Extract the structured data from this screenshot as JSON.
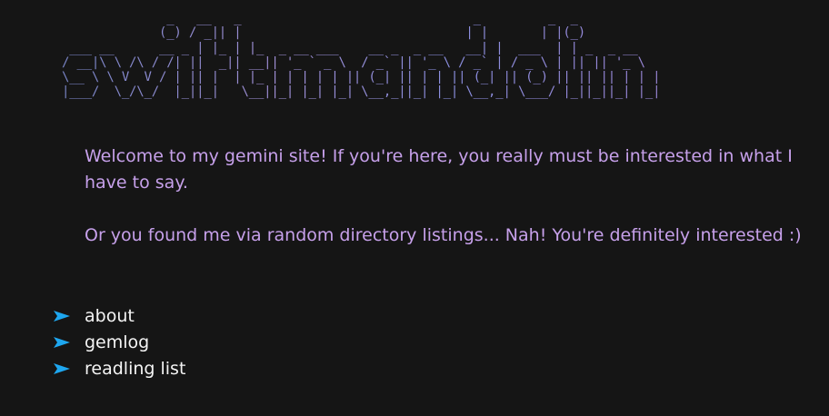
{
  "banner": {
    "ascii_art": "              _   __   _                               _         _  _\n             (_) / _|| |                              | |       | |(_)\n ___ __      __ _ | |_ | |_  _ __ ___    __ _  _ __   __| |  ___  | | _  _ __\n/ __|\\ \\ /\\ / /| ||  _|| __|| '_ ` _ \\  / _` || '_ \\ / _` | / _ \\ | || || '_ \\\n\\__ \\ \\ V  V / | || |  | |_ | | | | | || (_| || | | || (_| || (_) || || || | | |\n|___/  \\_/\\_/  |_||_|   \\__||_| |_| |_| \\__,_||_| |_| \\__,_| \\___/ |_||_||_| |_|",
    "colors": {
      "gradient_start": "#7a86c9",
      "gradient_mid": "#a08fd6",
      "gradient_end": "#9a86d6"
    }
  },
  "intro": {
    "welcome": "Welcome to my gemini site! If you're here, you really must be interested in what I have to say.",
    "aside": "Or you found me via random directory listings... Nah! You're definitely interested :)",
    "color": "#c6a0ea"
  },
  "links": [
    {
      "label": "about",
      "icon": "arrow-right-icon"
    },
    {
      "label": "gemlog",
      "icon": "arrow-right-icon"
    },
    {
      "label": "readling list",
      "icon": "arrow-right-icon"
    }
  ],
  "theme": {
    "background": "#151515",
    "link_text": "#f4f4f4",
    "arrow_color": "#1ea7f0"
  }
}
